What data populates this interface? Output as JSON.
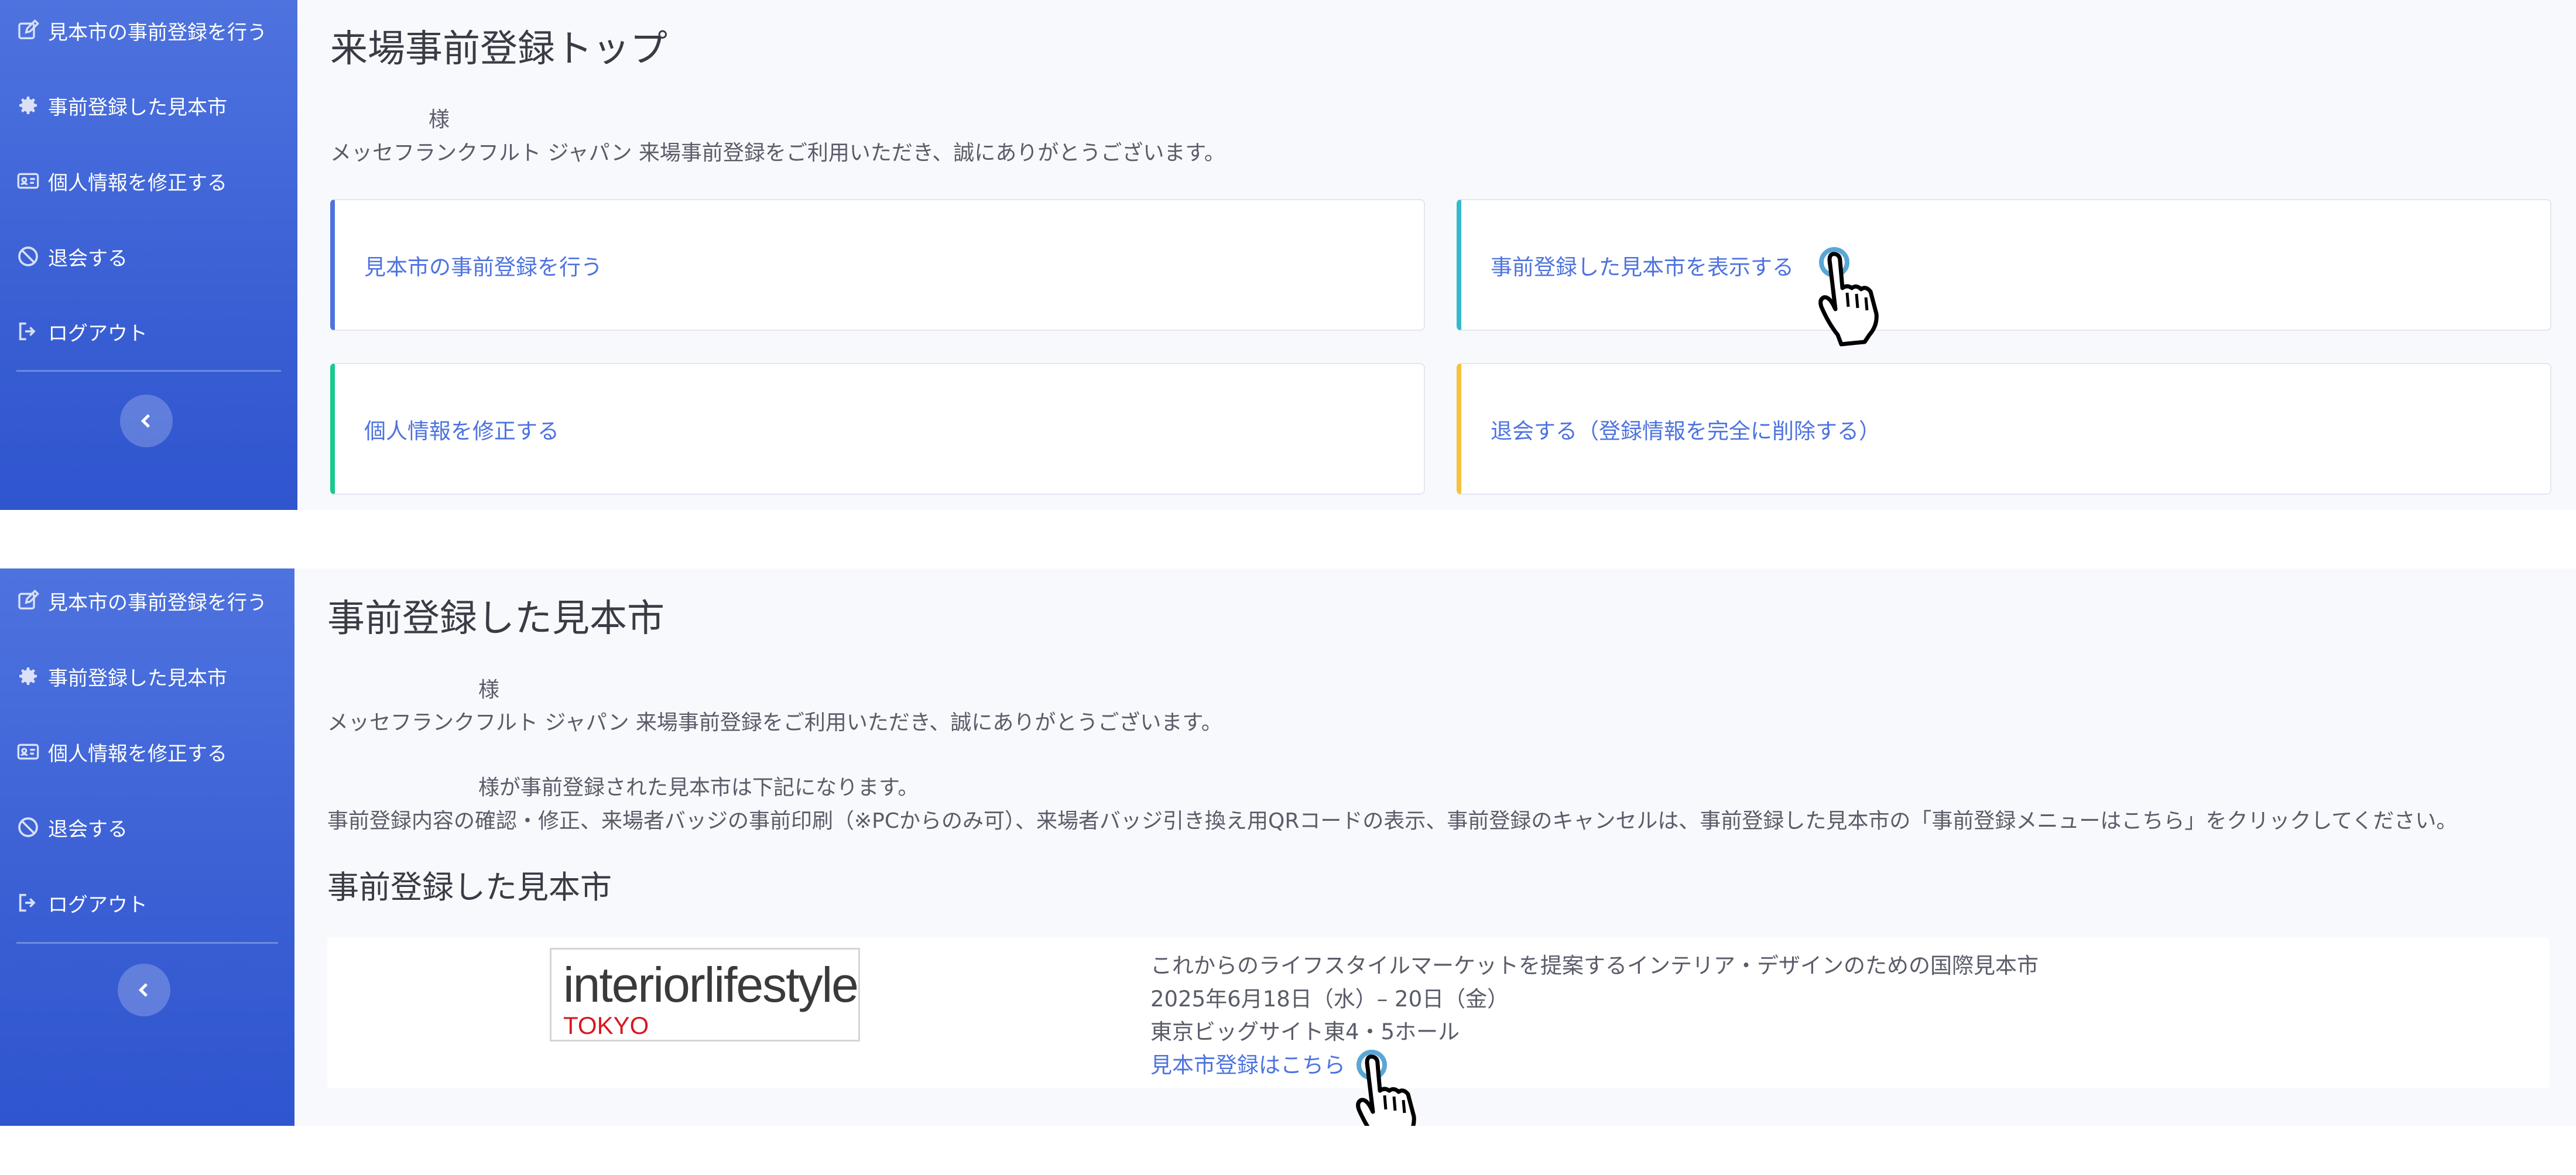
{
  "sidebar": {
    "items": [
      {
        "label": "見本市の事前登録を行う",
        "icon": "edit-icon"
      },
      {
        "label": "事前登録した見本市",
        "icon": "gear-icon"
      },
      {
        "label": "個人情報を修正する",
        "icon": "id-card-icon"
      },
      {
        "label": "退会する",
        "icon": "ban-icon"
      },
      {
        "label": "ログアウト",
        "icon": "sign-out-icon"
      }
    ],
    "toggle_icon": "chevron-left-icon"
  },
  "top_page": {
    "title": "来場事前登録トップ",
    "greeting_suffix": "様",
    "welcome": "メッセフランクフルト ジャパン 来場事前登録をご利用いただき、誠にありがとうございます。",
    "cards": [
      {
        "label": "見本市の事前登録を行う"
      },
      {
        "label": "事前登録した見本市を表示する"
      },
      {
        "label": "個人情報を修正する"
      },
      {
        "label": "退会する（登録情報を完全に削除する）"
      }
    ]
  },
  "registered_page": {
    "title": "事前登録した見本市",
    "greeting_suffix": "様",
    "welcome": "メッセフランクフルト ジャパン 来場事前登録をご利用いただき、誠にありがとうございます。",
    "registered_note": "様が事前登録された見本市は下記になります。",
    "instructions": "事前登録内容の確認・修正、来場者バッジの事前印刷（※PCからのみ可）、来場者バッジ引き換え用QRコードの表示、事前登録のキャンセルは、事前登録した見本市の「事前登録メニューはこちら」をクリックしてください。",
    "section_heading": "事前登録した見本市",
    "fair": {
      "logo_main": "interiorlifestyle",
      "logo_sub": "TOKYO",
      "description": "これからのライフスタイルマーケットを提案するインテリア・デザインのための国際見本市",
      "dates": "2025年6月18日（水）– 20日（金）",
      "venue": "東京ビッグサイト東4・5ホール",
      "link": "見本市登録はこちら"
    }
  },
  "colors": {
    "sidebar": "#4e73df",
    "primary": "#4e73df",
    "info": "#36b9cc",
    "success": "#1cc88a",
    "warning": "#f6c23e",
    "logo_accent": "#d71921"
  }
}
